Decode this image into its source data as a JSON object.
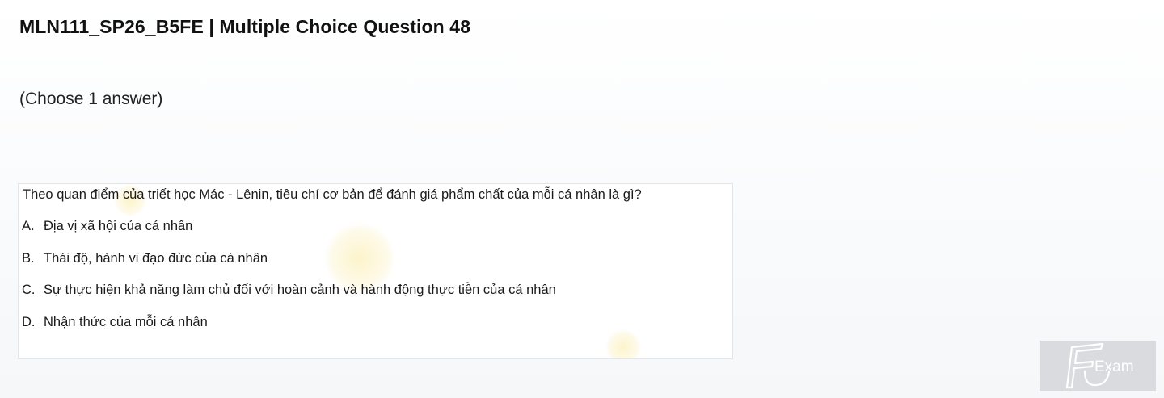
{
  "page": {
    "title": "MLN111_SP26_B5FE | Multiple Choice Question 48",
    "instruction": "(Choose 1 answer)"
  },
  "question": {
    "text": "Theo quan điểm của triết học Mác - Lênin, tiêu chí cơ bản để đánh giá phẩm chất của mỗi cá nhân là gì?",
    "options": [
      {
        "letter": "A.",
        "text": "Địa vị xã hội của cá nhân"
      },
      {
        "letter": "B.",
        "text": "Thái độ, hành vi đạo đức của cá nhân"
      },
      {
        "letter": "C.",
        "text": "Sự thực hiện khả năng làm chủ đối với hoàn cảnh và hành động thực tiễn của cá nhân"
      },
      {
        "letter": "D.",
        "text": "Nhận thức của mỗi cá nhân"
      }
    ]
  },
  "logo": {
    "text": "Exam",
    "icon": "fu-exam-logo-icon"
  }
}
